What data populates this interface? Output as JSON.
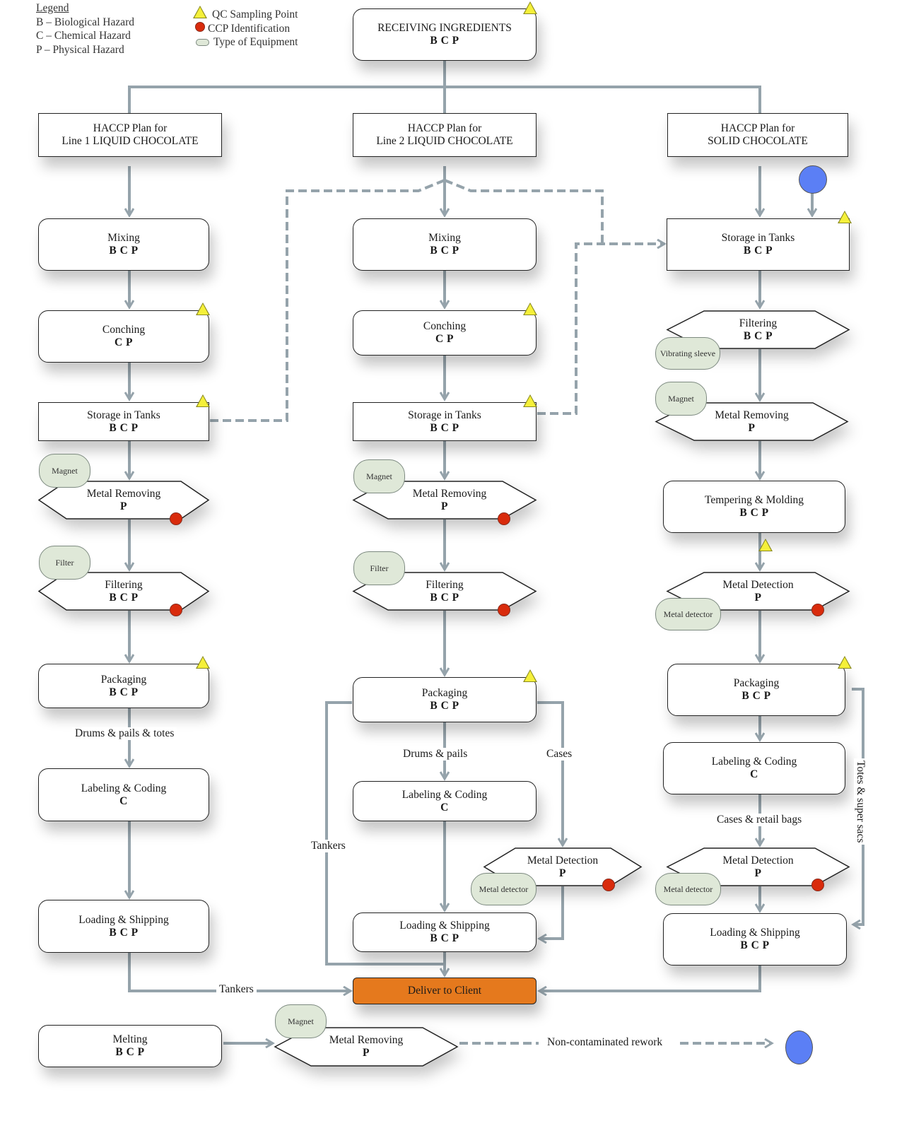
{
  "legend": {
    "title": "Legend",
    "hazards": [
      "B – Biological Hazard",
      "C – Chemical Hazard",
      "P – Physical Hazard"
    ],
    "symbols": [
      {
        "icon": "yellow-triangle",
        "label": "QC Sampling Point"
      },
      {
        "icon": "red-circle",
        "label": "CCP Identification"
      },
      {
        "icon": "green-rounded-rect",
        "label": "Type of Equipment"
      }
    ]
  },
  "colors": {
    "connector": "#95a3ab",
    "qc_triangle": "#f5f03a",
    "ccp_circle": "#d92b0c",
    "equipment": "#dfe8d8",
    "deliver": "#e5791d",
    "rework": "#5b7ff5"
  },
  "top": {
    "title": "RECEIVING INGREDIENTS",
    "hazards": "B C P"
  },
  "plans": [
    {
      "line1": "HACCP Plan for",
      "line2": "Line 1 LIQUID CHOCOLATE"
    },
    {
      "line1": "HACCP Plan for",
      "line2": "Line 2 LIQUID CHOCOLATE"
    },
    {
      "line1": "HACCP Plan for",
      "line2": "SOLID CHOCOLATE"
    }
  ],
  "line1": {
    "mixing": {
      "title": "Mixing",
      "hazards": "B C P"
    },
    "conching": {
      "title": "Conching",
      "hazards": "C P"
    },
    "storage": {
      "title": "Storage in Tanks",
      "hazards": "B C P"
    },
    "metal_removing": {
      "title": "Metal Removing",
      "hazards": "P",
      "equipment": "Magnet"
    },
    "filtering": {
      "title": "Filtering",
      "hazards": "B C P",
      "equipment": "Filter"
    },
    "packaging": {
      "title": "Packaging",
      "hazards": "B C P"
    },
    "pack_label": "Drums & pails & totes",
    "labeling": {
      "title": "Labeling & Coding",
      "hazards": "C"
    },
    "loading": {
      "title": "Loading & Shipping",
      "hazards": "B C P"
    },
    "ship_label": "Tankers"
  },
  "line2": {
    "mixing": {
      "title": "Mixing",
      "hazards": "B C P"
    },
    "conching": {
      "title": "Conching",
      "hazards": "C P"
    },
    "storage": {
      "title": "Storage in Tanks",
      "hazards": "B C P"
    },
    "metal_removing": {
      "title": "Metal Removing",
      "hazards": "P",
      "equipment": "Magnet"
    },
    "filtering": {
      "title": "Filtering",
      "hazards": "B C P",
      "equipment": "Filter"
    },
    "packaging": {
      "title": "Packaging",
      "hazards": "B C P"
    },
    "drums_label": "Drums & pails",
    "cases_label": "Cases",
    "tankers_label": "Tankers",
    "labeling": {
      "title": "Labeling & Coding",
      "hazards": "C"
    },
    "metal_detection": {
      "title": "Metal Detection",
      "hazards": "P",
      "equipment": "Metal detector"
    },
    "loading": {
      "title": "Loading & Shipping",
      "hazards": "B C P"
    }
  },
  "solid": {
    "storage": {
      "title": "Storage in Tanks",
      "hazards": "B C P"
    },
    "filtering": {
      "title": "Filtering",
      "hazards": "B C P",
      "equipment": "Vibrating sleeve"
    },
    "metal_removing": {
      "title": "Metal Removing",
      "hazards": "P",
      "equipment": "Magnet"
    },
    "tempering": {
      "title": "Tempering & Molding",
      "hazards": "B C P"
    },
    "metal_detection_1": {
      "title": "Metal Detection",
      "hazards": "P",
      "equipment": "Metal detector"
    },
    "packaging": {
      "title": "Packaging",
      "hazards": "B C P"
    },
    "labeling": {
      "title": "Labeling & Coding",
      "hazards": "C"
    },
    "cases_label": "Cases & retail bags",
    "totes_label": "Totes & super sacs",
    "metal_detection_2": {
      "title": "Metal Detection",
      "hazards": "P",
      "equipment": "Metal detector"
    },
    "loading": {
      "title": "Loading & Shipping",
      "hazards": "B C P"
    }
  },
  "deliver": {
    "title": "Deliver to Client"
  },
  "rework": {
    "melting": {
      "title": "Melting",
      "hazards": "B C P"
    },
    "metal_removing": {
      "title": "Metal Removing",
      "hazards": "P",
      "equipment": "Magnet"
    },
    "label": "Non-contaminated rework"
  }
}
